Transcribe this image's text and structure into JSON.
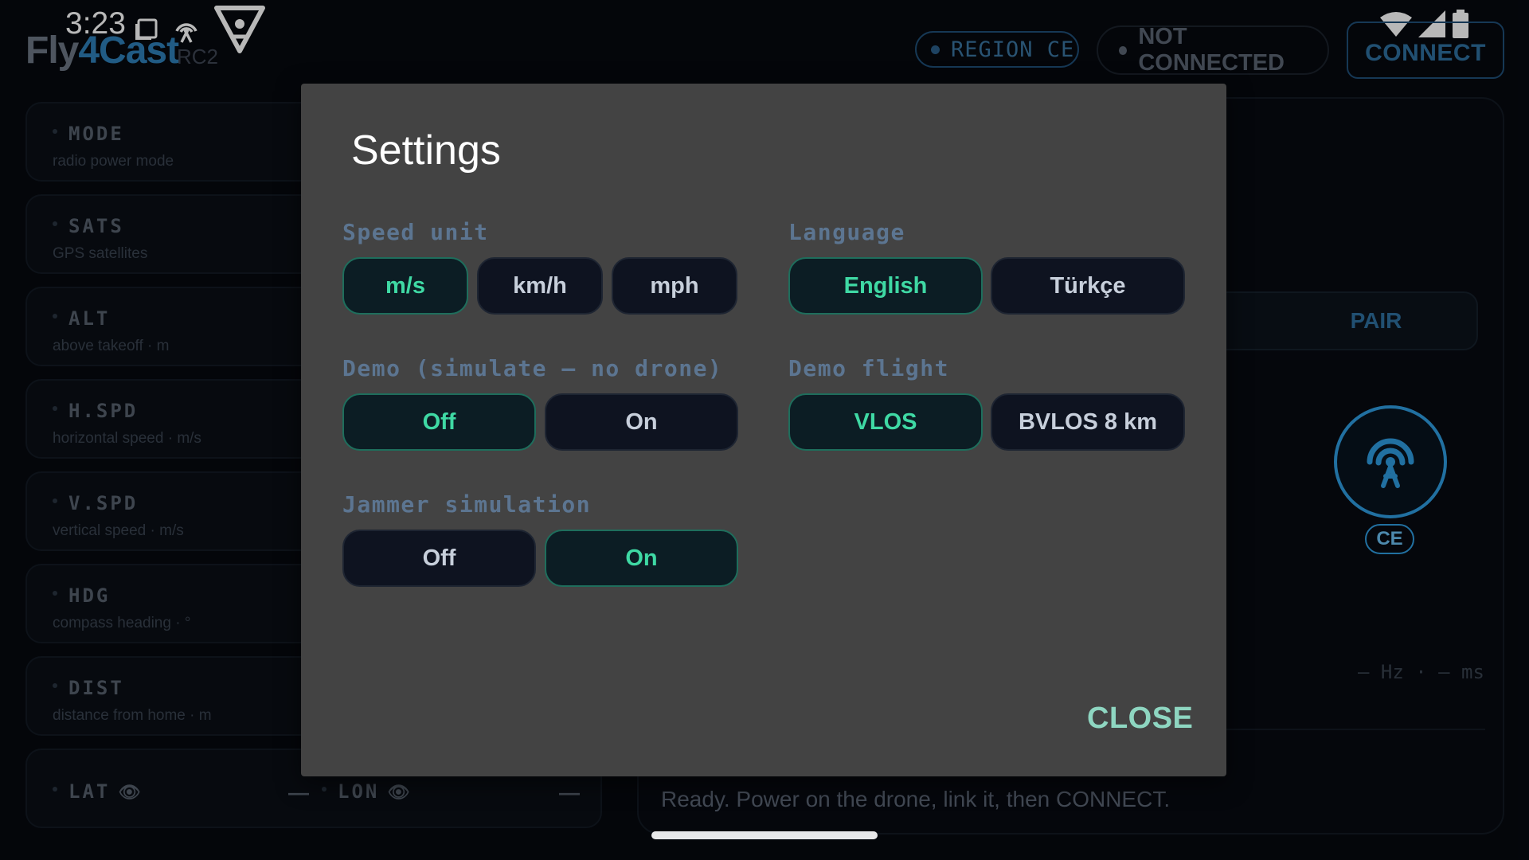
{
  "status_bar": {
    "time": "3:23"
  },
  "header": {
    "logo_fly": "Fly",
    "logo_4cast": "4Cast",
    "logo_model": "RC2",
    "region_pill": "REGION CE",
    "connection_status": "NOT CONNECTED",
    "connect_label": "CONNECT"
  },
  "telemetry": [
    {
      "title": "MODE",
      "subtitle": "radio power mode"
    },
    {
      "title": "SATS",
      "subtitle": "GPS satellites"
    },
    {
      "title": "ALT",
      "subtitle": "above takeoff · m"
    },
    {
      "title": "H.SPD",
      "subtitle": "horizontal speed · m/s"
    },
    {
      "title": "V.SPD",
      "subtitle": "vertical speed · m/s"
    },
    {
      "title": "HDG",
      "subtitle": "compass heading · °"
    },
    {
      "title": "DIST",
      "subtitle": "distance from home · m"
    }
  ],
  "position": {
    "lat_label": "LAT",
    "lat_value": "—",
    "lon_label": "LON",
    "lon_value": "—"
  },
  "right_panel": {
    "pair_label": "PAIR",
    "region_badge": "CE",
    "link_stats": "— Hz · — ms",
    "message": "Ready. Power on the drone, link it, then CONNECT."
  },
  "settings": {
    "title": "Settings",
    "speed_unit": {
      "label": "Speed unit",
      "options": [
        "m/s",
        "km/h",
        "mph"
      ],
      "selected": "m/s"
    },
    "language": {
      "label": "Language",
      "options": [
        "English",
        "Türkçe"
      ],
      "selected": "English"
    },
    "demo": {
      "label": "Demo (simulate — no drone)",
      "options": [
        "Off",
        "On"
      ],
      "selected": "Off"
    },
    "demo_flight": {
      "label": "Demo flight",
      "options": [
        "VLOS",
        "BVLOS 8 km"
      ],
      "selected": "VLOS"
    },
    "jammer": {
      "label": "Jammer simulation",
      "options": [
        "Off",
        "On"
      ],
      "selected": "On"
    },
    "close_label": "CLOSE"
  },
  "colors": {
    "accent_selected": "#3fd9a4",
    "accent_blue": "#2f9be0",
    "dialog_bg": "#434343"
  }
}
